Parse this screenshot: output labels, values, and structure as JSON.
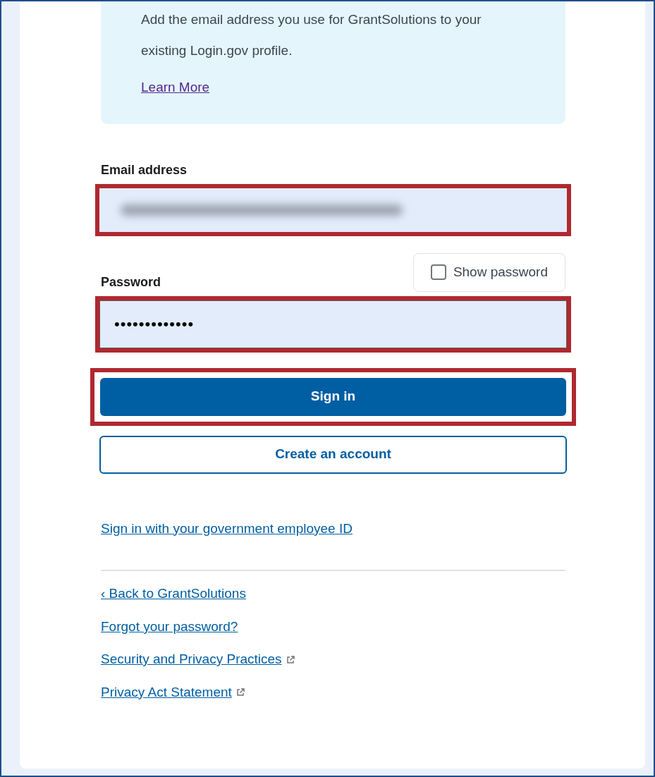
{
  "notice": {
    "text": "Add the email address you use for GrantSolutions to your existing Login.gov profile.",
    "link": "Learn More"
  },
  "email": {
    "label": "Email address",
    "blurred": true,
    "highlighted": true
  },
  "show_password": {
    "label": "Show password",
    "checked": false
  },
  "password": {
    "label": "Password",
    "value": "•••••••••••••",
    "highlighted": true
  },
  "buttons": [
    {
      "label": "Sign in",
      "kind": "primary",
      "highlighted": true
    },
    {
      "label": "Create an account",
      "kind": "outline",
      "highlighted": false
    }
  ],
  "piv_link": "Sign in with your government employee ID",
  "footer_links": [
    {
      "label": "‹ Back to GrantSolutions",
      "external": false
    },
    {
      "label": "Forgot your password?",
      "external": false
    },
    {
      "label": "Security and Privacy Practices",
      "external": true
    },
    {
      "label": "Privacy Act Statement",
      "external": true
    }
  ]
}
